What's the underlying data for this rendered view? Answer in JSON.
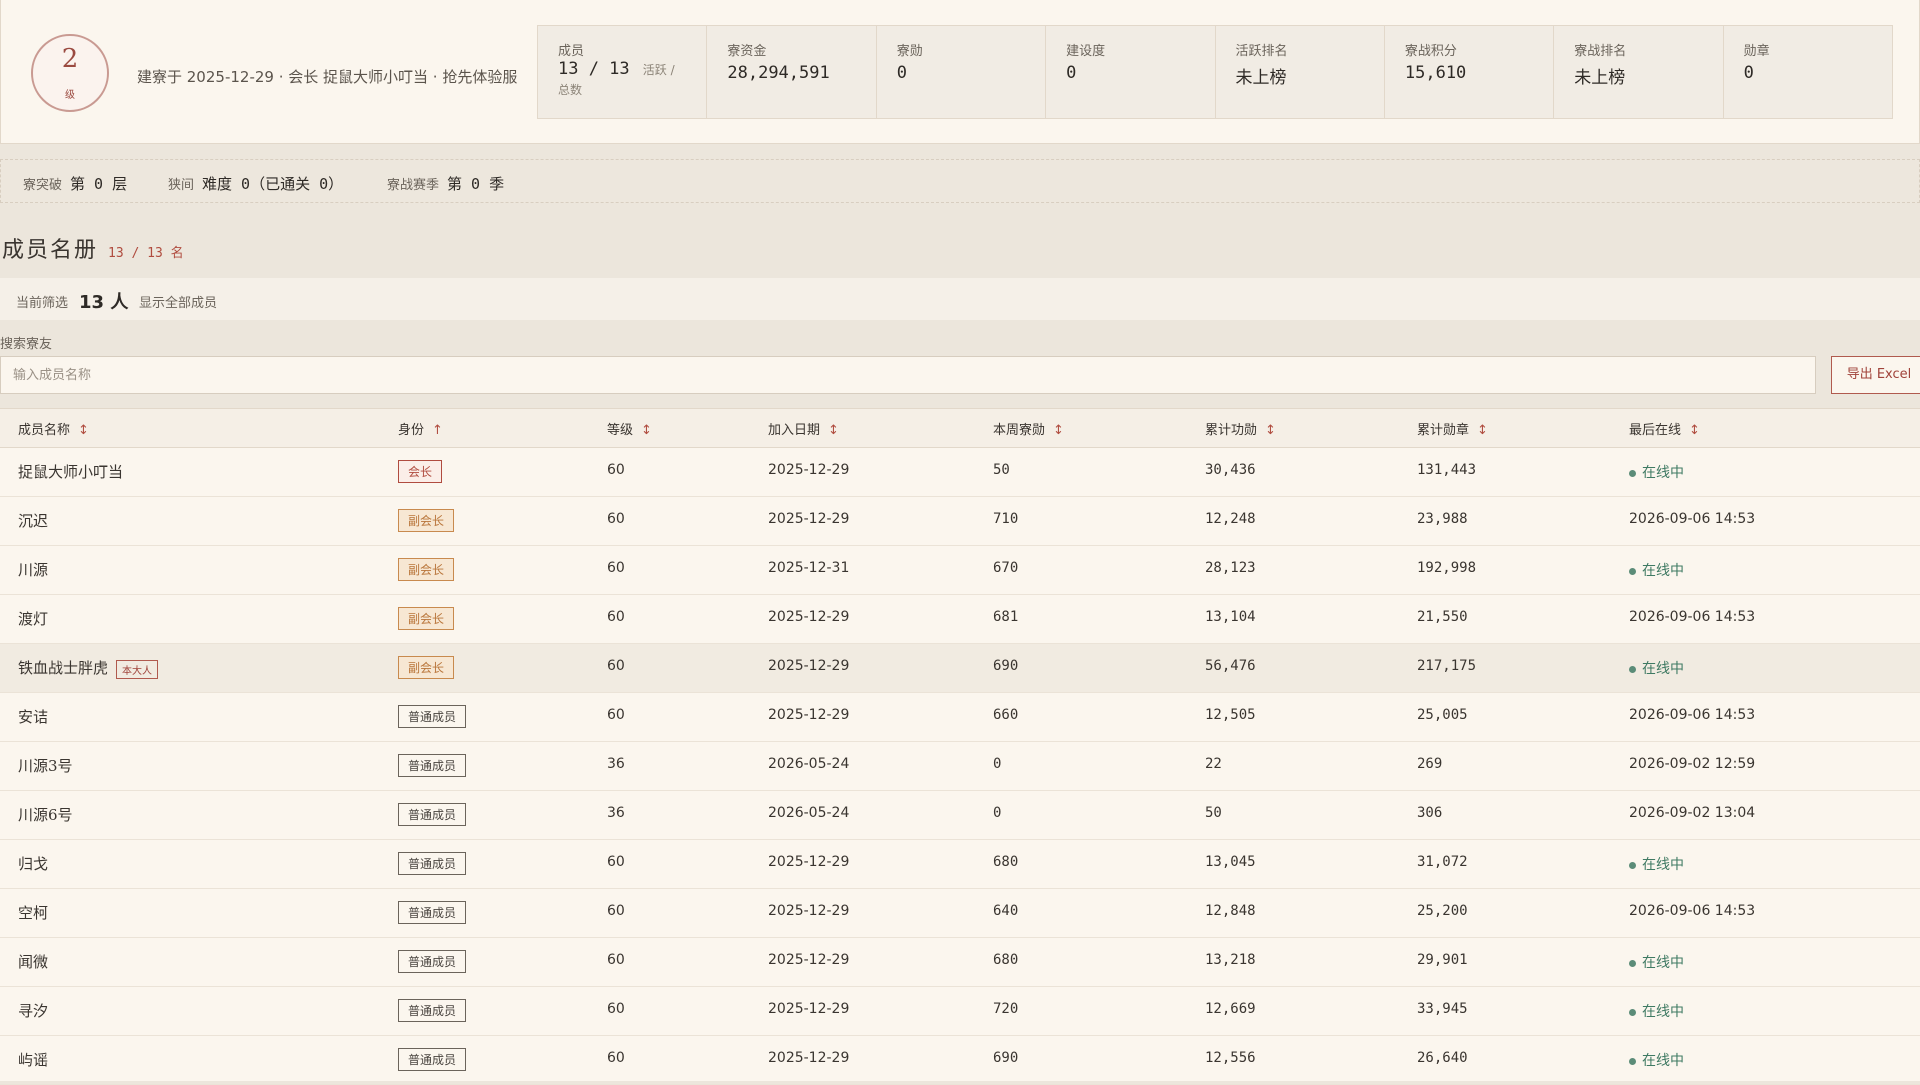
{
  "guild": {
    "level": "2",
    "level_unit": "级",
    "founded_line": "建寮于 2025-12-29 · 会长 捉鼠大师小叮当 · 抢先体验服"
  },
  "stats": [
    {
      "label": "成员",
      "value": "13 / 13",
      "sub": "活跃 / 总数"
    },
    {
      "label": "寮资金",
      "value": "28,294,591"
    },
    {
      "label": "寮勋",
      "value": "0"
    },
    {
      "label": "建设度",
      "value": "0"
    },
    {
      "label": "活跃排名",
      "value": "未上榜"
    },
    {
      "label": "寮战积分",
      "value": "15,610"
    },
    {
      "label": "寮战排名",
      "value": "未上榜"
    },
    {
      "label": "勋章",
      "value": "0"
    }
  ],
  "progress": [
    {
      "label": "寮突破",
      "value": "第 0 层"
    },
    {
      "label": "狭间",
      "value": "难度 0（已通关 0）"
    },
    {
      "label": "寮战赛季",
      "value": "第 0 季"
    }
  ],
  "roster": {
    "title": "成员名册",
    "count": "13 / 13 名",
    "filter_label": "当前筛选",
    "filter_value": "13 人",
    "filter_show": "显示全部成员",
    "search_label": "搜索寮友",
    "search_placeholder": "输入成员名称",
    "export_label": "导出 Excel"
  },
  "table": {
    "headers": [
      {
        "label": "成员名称",
        "sort": "↕"
      },
      {
        "label": "身份",
        "sort": "↑"
      },
      {
        "label": "等级",
        "sort": "↕"
      },
      {
        "label": "加入日期",
        "sort": "↕"
      },
      {
        "label": "本周寮勋",
        "sort": "↕"
      },
      {
        "label": "累计功勋",
        "sort": "↕"
      },
      {
        "label": "累计勋章",
        "sort": "↕"
      },
      {
        "label": "最后在线",
        "sort": "↕"
      }
    ],
    "self_tag": "本大人",
    "rows": [
      {
        "name": "捉鼠大师小叮当",
        "role": "会长",
        "role_type": "leader",
        "level": "60",
        "join": "2025-12-29",
        "weekly": "50",
        "merit": "30,436",
        "medal": "131,443",
        "last": "在线中",
        "online": true
      },
      {
        "name": "沉迟",
        "role": "副会长",
        "role_type": "vice",
        "level": "60",
        "join": "2025-12-29",
        "weekly": "710",
        "merit": "12,248",
        "medal": "23,988",
        "last": "2026-09-06 14:53",
        "online": false
      },
      {
        "name": "川源",
        "role": "副会长",
        "role_type": "vice",
        "level": "60",
        "join": "2025-12-31",
        "weekly": "670",
        "merit": "28,123",
        "medal": "192,998",
        "last": "在线中",
        "online": true
      },
      {
        "name": "渡灯",
        "role": "副会长",
        "role_type": "vice",
        "level": "60",
        "join": "2025-12-29",
        "weekly": "681",
        "merit": "13,104",
        "medal": "21,550",
        "last": "2026-09-06 14:53",
        "online": false
      },
      {
        "name": "铁血战士胖虎",
        "role": "副会长",
        "role_type": "vice",
        "level": "60",
        "join": "2025-12-29",
        "weekly": "690",
        "merit": "56,476",
        "medal": "217,175",
        "last": "在线中",
        "online": true,
        "self": true
      },
      {
        "name": "安诘",
        "role": "普通成员",
        "role_type": "member",
        "level": "60",
        "join": "2025-12-29",
        "weekly": "660",
        "merit": "12,505",
        "medal": "25,005",
        "last": "2026-09-06 14:53",
        "online": false
      },
      {
        "name": "川源3号",
        "role": "普通成员",
        "role_type": "member",
        "level": "36",
        "join": "2026-05-24",
        "weekly": "0",
        "merit": "22",
        "medal": "269",
        "last": "2026-09-02 12:59",
        "online": false
      },
      {
        "name": "川源6号",
        "role": "普通成员",
        "role_type": "member",
        "level": "36",
        "join": "2026-05-24",
        "weekly": "0",
        "merit": "50",
        "medal": "306",
        "last": "2026-09-02 13:04",
        "online": false
      },
      {
        "name": "归戈",
        "role": "普通成员",
        "role_type": "member",
        "level": "60",
        "join": "2025-12-29",
        "weekly": "680",
        "merit": "13,045",
        "medal": "31,072",
        "last": "在线中",
        "online": true
      },
      {
        "name": "空柯",
        "role": "普通成员",
        "role_type": "member",
        "level": "60",
        "join": "2025-12-29",
        "weekly": "640",
        "merit": "12,848",
        "medal": "25,200",
        "last": "2026-09-06 14:53",
        "online": false
      },
      {
        "name": "闻微",
        "role": "普通成员",
        "role_type": "member",
        "level": "60",
        "join": "2025-12-29",
        "weekly": "680",
        "merit": "13,218",
        "medal": "29,901",
        "last": "在线中",
        "online": true
      },
      {
        "name": "寻汐",
        "role": "普通成员",
        "role_type": "member",
        "level": "60",
        "join": "2025-12-29",
        "weekly": "720",
        "merit": "12,669",
        "medal": "33,945",
        "last": "在线中",
        "online": true
      },
      {
        "name": "屿谣",
        "role": "普通成员",
        "role_type": "member",
        "level": "60",
        "join": "2025-12-29",
        "weekly": "690",
        "merit": "12,556",
        "medal": "26,640",
        "last": "在线中",
        "online": true
      }
    ]
  }
}
